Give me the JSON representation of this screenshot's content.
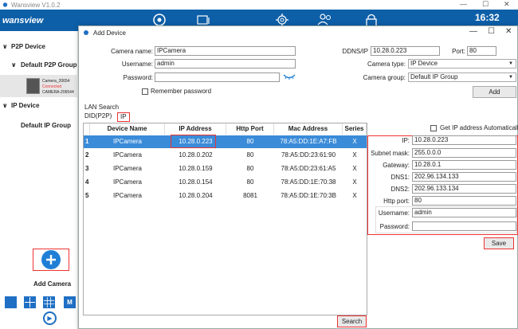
{
  "app": {
    "title": "Wansview  V1.0.2",
    "brand": "wansview",
    "clock": "16:32",
    "min": "—",
    "max": "☐",
    "close": "✕"
  },
  "sidebar": {
    "p2p_device": "P2P Device",
    "p2p_group": "Default P2P Group",
    "camera_name": "Camera_20654",
    "camera_status": "Connected",
    "camera_id": "CAMERA-206544",
    "ip_device": "IP Device",
    "ip_group": "Default IP Group",
    "add_camera": "Add Camera",
    "chevron": "∨",
    "view_m": "M"
  },
  "dialog": {
    "title": "Add Device",
    "min": "—",
    "max": "☐",
    "close": "✕",
    "camera_name_label": "Camera name:",
    "camera_name": "IPCamera",
    "username_label": "Username:",
    "username": "admin",
    "password_label": "Password:",
    "password": "",
    "remember_label": "Remember password",
    "ddns_label": "DDNS/IP",
    "ddns": "10.28.0.223",
    "port_label": "Port:",
    "port": "80",
    "camera_type_label": "Camera type:",
    "camera_type": "IP Device",
    "camera_group_label": "Camera group:",
    "camera_group": "Default IP Group",
    "add_button": "Add",
    "lan_search": "LAN Search",
    "tabs": [
      "DID(P2P)",
      "IP"
    ],
    "search_button": "Search"
  },
  "table": {
    "headers": [
      "Device Name",
      "IP Address",
      "Http Port",
      "Mac Address",
      "Series"
    ],
    "rows": [
      [
        "1",
        "IPCamera",
        "10.28.0.223",
        "80",
        "78:A5:DD:1E:A7:FB",
        "X"
      ],
      [
        "2",
        "IPCamera",
        "10.28.0.202",
        "80",
        "78:A5:DD:23:61:90",
        "X"
      ],
      [
        "3",
        "IPCamera",
        "10.28.0.159",
        "80",
        "78:A5:DD:23:61:A5",
        "X"
      ],
      [
        "4",
        "IPCamera",
        "10.28.0.154",
        "80",
        "78:A5:DD:1E:70:38",
        "X"
      ],
      [
        "5",
        "IPCamera",
        "10.28.0.204",
        "8081",
        "78:A5:DD:1E:70:3B",
        "X"
      ]
    ]
  },
  "net": {
    "auto_label": "Get IP address Automatically",
    "ip_label": "IP:",
    "ip": "10.28.0.223",
    "mask_label": "Subnet mask:",
    "mask": "255.0.0.0",
    "gw_label": "Gateway:",
    "gw": "10.28.0.1",
    "dns1_label": "DNS1:",
    "dns1": "202.96.134.133",
    "dns2_label": "DNS2:",
    "dns2": "202.96.133.134",
    "http_label": "Http port:",
    "http": "80",
    "user_label": "Username:",
    "user": "admin",
    "pass_label": "Password:",
    "pass": "",
    "save_button": "Save"
  },
  "colors": {
    "brand": "#0d5fa8",
    "selected_row": "#3a8bd8",
    "highlight": "#e33333"
  }
}
